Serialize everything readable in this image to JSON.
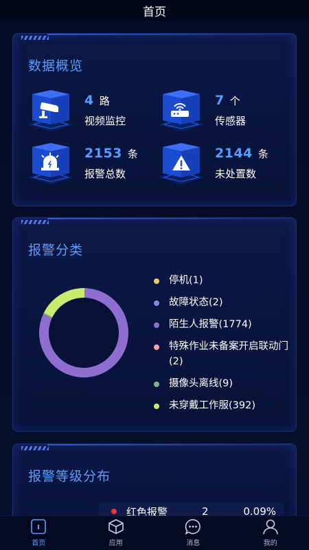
{
  "header": {
    "title": "首页"
  },
  "overview": {
    "title": "数据概览",
    "stats": [
      {
        "value": "4",
        "unit": "路",
        "label": "视频监控",
        "icon": "camera-icon"
      },
      {
        "value": "7",
        "unit": "个",
        "label": "传感器",
        "icon": "router-icon"
      },
      {
        "value": "2153",
        "unit": "条",
        "label": "报警总数",
        "icon": "alarm-light-icon"
      },
      {
        "value": "2144",
        "unit": "条",
        "label": "未处置数",
        "icon": "warning-icon"
      }
    ]
  },
  "category": {
    "title": "报警分类",
    "legend": [
      {
        "label": "停机(1)",
        "color": "#f5c76a"
      },
      {
        "label": "故障状态(2)",
        "color": "#7c8ce6"
      },
      {
        "label": "陌生人报警(1774)",
        "color": "#8e6fd0"
      },
      {
        "label": "特殊作业未备案开启联动门(2)",
        "color": "#f3a3ad"
      },
      {
        "label": "摄像头离线(9)",
        "color": "#7fb487"
      },
      {
        "label": "未穿戴工作服(392)",
        "color": "#c9ec6e"
      }
    ]
  },
  "chart_data": {
    "type": "pie",
    "categories": [
      "停机",
      "故障状态",
      "陌生人报警",
      "特殊作业未备案开启联动门",
      "摄像头离线",
      "未穿戴工作服"
    ],
    "values": [
      1,
      2,
      1774,
      2,
      9,
      392
    ],
    "colors": [
      "#f5c76a",
      "#7c8ce6",
      "#8e6fd0",
      "#f3a3ad",
      "#7fb487",
      "#c9ec6e"
    ],
    "donut": true
  },
  "level": {
    "title": "报警等级分布",
    "rows": [
      {
        "name": "红色报警",
        "count": "2",
        "percent": "0.09%",
        "color": "#e53935"
      }
    ]
  },
  "tabs": [
    {
      "label": "首页",
      "icon": "home-icon",
      "active": true
    },
    {
      "label": "应用",
      "icon": "cube-icon",
      "active": false
    },
    {
      "label": "消息",
      "icon": "chat-icon",
      "active": false
    },
    {
      "label": "我的",
      "icon": "user-icon",
      "active": false
    }
  ]
}
